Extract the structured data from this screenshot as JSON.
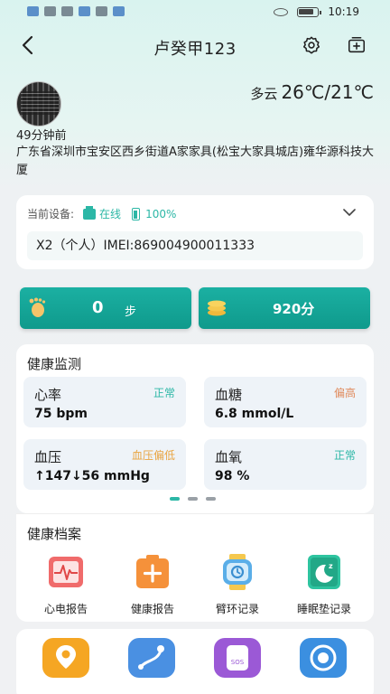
{
  "status_bar": {
    "time": "10:19"
  },
  "header": {
    "title": "卢癸甲123"
  },
  "location": {
    "weather_desc": "多云",
    "temperature": "26℃/21℃",
    "time_ago": "49分钟前",
    "address": "广东省深圳市宝安区西乡街道A家家具(松宝大家具城店)雍华源科技大厦"
  },
  "device": {
    "label": "当前设备:",
    "status": "在线",
    "battery": "100%",
    "imei": "X2（个人）IMEI:869004900011333"
  },
  "stats": {
    "steps_value": "0",
    "steps_unit": "步",
    "score": "920分"
  },
  "health": {
    "title": "健康监测",
    "items": [
      {
        "label": "心率",
        "status": "正常",
        "value": "75 bpm"
      },
      {
        "label": "血糖",
        "status": "偏高",
        "value": "6.8 mmol/L"
      },
      {
        "label": "血压",
        "status": "血压偏低",
        "value": "↑147↓56 mmHg"
      },
      {
        "label": "血氧",
        "status": "正常",
        "value": "98 %"
      }
    ]
  },
  "archive": {
    "title": "健康档案",
    "items": [
      {
        "label": "心电报告",
        "icon": "ecg-report-icon",
        "color": "#f06b6b"
      },
      {
        "label": "健康报告",
        "icon": "health-report-icon",
        "color": "#f5913a"
      },
      {
        "label": "臂环记录",
        "icon": "armband-icon",
        "color": "#5aaee8"
      },
      {
        "label": "睡眠垫记录",
        "icon": "sleep-pad-icon",
        "color": "#2ec4a0"
      }
    ]
  },
  "bottom_items": [
    {
      "icon": "location-icon",
      "color": "#f5a623"
    },
    {
      "icon": "track-icon",
      "color": "#4a90e2"
    },
    {
      "icon": "sos-icon",
      "color": "#9b59d6"
    },
    {
      "icon": "fence-icon",
      "color": "#3b8fe0"
    }
  ],
  "colors": {
    "accent": "#1bb0a2"
  }
}
